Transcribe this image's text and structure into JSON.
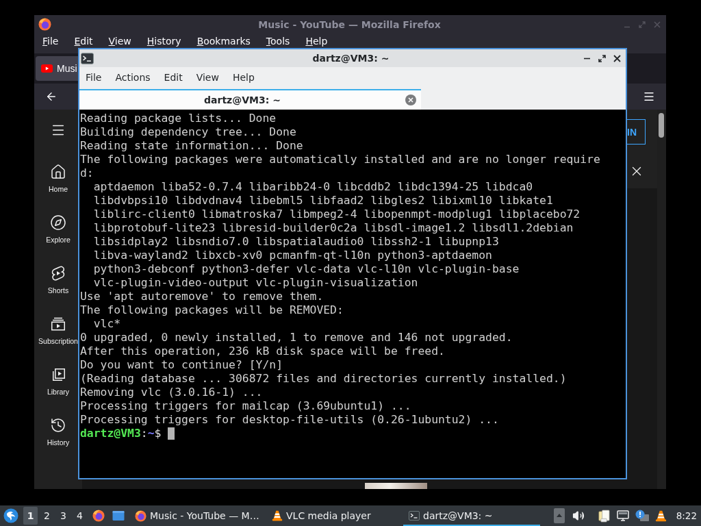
{
  "firefox": {
    "title": "Music - YouTube — Mozilla Firefox",
    "menu": [
      "File",
      "Edit",
      "View",
      "History",
      "Bookmarks",
      "Tools",
      "Help"
    ],
    "tabs": [
      {
        "label": "Musi",
        "selected": true
      }
    ],
    "youtube": {
      "guide": [
        {
          "label": "Home",
          "kind": "home"
        },
        {
          "label": "Explore",
          "kind": "explore"
        },
        {
          "label": "Shorts",
          "kind": "shorts"
        },
        {
          "label": "Subscription",
          "kind": "subscriptions"
        },
        {
          "label": "Library",
          "kind": "library"
        },
        {
          "label": "History",
          "kind": "history"
        }
      ],
      "sign_in_button": "IN"
    }
  },
  "terminal": {
    "title": "dartz@VM3: ~",
    "menu": [
      "File",
      "Actions",
      "Edit",
      "View",
      "Help"
    ],
    "tabs": [
      {
        "label": "dartz@VM3: ~",
        "selected": true
      }
    ],
    "lines": [
      {
        "text": "Reading package lists... Done",
        "kind": "plain"
      },
      {
        "text": "Building dependency tree... Done",
        "kind": "plain"
      },
      {
        "text": "Reading state information... Done",
        "kind": "plain"
      },
      {
        "text": "The following packages were automatically installed and are no longer require",
        "kind": "plain"
      },
      {
        "text": "d:",
        "kind": "plain"
      },
      {
        "text": "aptdaemon liba52-0.7.4 libaribb24-0 libcddb2 libdc1394-25 libdca0",
        "kind": "indented"
      },
      {
        "text": "libdvbpsi10 libdvdnav4 libebml5 libfaad2 libgles2 libixml10 libkate1",
        "kind": "indented"
      },
      {
        "text": "liblirc-client0 libmatroska7 libmpeg2-4 libopenmpt-modplug1 libplacebo72",
        "kind": "indented"
      },
      {
        "text": "libprotobuf-lite23 libresid-builder0c2a libsdl-image1.2 libsdl1.2debian",
        "kind": "indented"
      },
      {
        "text": "libsidplay2 libsndio7.0 libspatialaudio0 libssh2-1 libupnp13",
        "kind": "indented"
      },
      {
        "text": "libva-wayland2 libxcb-xv0 pcmanfm-qt-l10n python3-aptdaemon",
        "kind": "indented"
      },
      {
        "text": "python3-debconf python3-defer vlc-data vlc-l10n vlc-plugin-base",
        "kind": "indented"
      },
      {
        "text": "vlc-plugin-video-output vlc-plugin-visualization",
        "kind": "indented"
      },
      {
        "text": "Use 'apt autoremove' to remove them.",
        "kind": "plain"
      },
      {
        "text": "The following packages will be REMOVED:",
        "kind": "plain"
      },
      {
        "text": "vlc*",
        "kind": "indented"
      },
      {
        "text": "0 upgraded, 0 newly installed, 1 to remove and 146 not upgraded.",
        "kind": "plain"
      },
      {
        "text": "After this operation, 236 kB disk space will be freed.",
        "kind": "plain"
      },
      {
        "text": "Do you want to continue? [Y/n]",
        "kind": "plain"
      },
      {
        "text": "(Reading database ... 306872 files and directories currently installed.)",
        "kind": "plain"
      },
      {
        "text": "Removing vlc (3.0.16-1) ...",
        "kind": "plain"
      },
      {
        "text": "Processing triggers for mailcap (3.69ubuntu1) ...",
        "kind": "plain"
      },
      {
        "text": "Processing triggers for desktop-file-utils (0.26-1ubuntu2) ...",
        "kind": "plain"
      }
    ],
    "prompt": {
      "user": "dartz@VM3",
      "separator": ":",
      "cwd": "~",
      "symbol": "$"
    }
  },
  "taskbar": {
    "workspaces": [
      {
        "label": "1",
        "selected": true
      },
      {
        "label": "2",
        "selected": false
      },
      {
        "label": "3",
        "selected": false
      },
      {
        "label": "4",
        "selected": false
      }
    ],
    "tasks": [
      {
        "label": "Music - YouTube — M…",
        "kind": "browser",
        "selected": false
      },
      {
        "label": "VLC media player",
        "kind": "media",
        "selected": false
      },
      {
        "label": "dartz@VM3: ~",
        "kind": "terminal",
        "selected": true
      }
    ],
    "clock": "8:22"
  }
}
